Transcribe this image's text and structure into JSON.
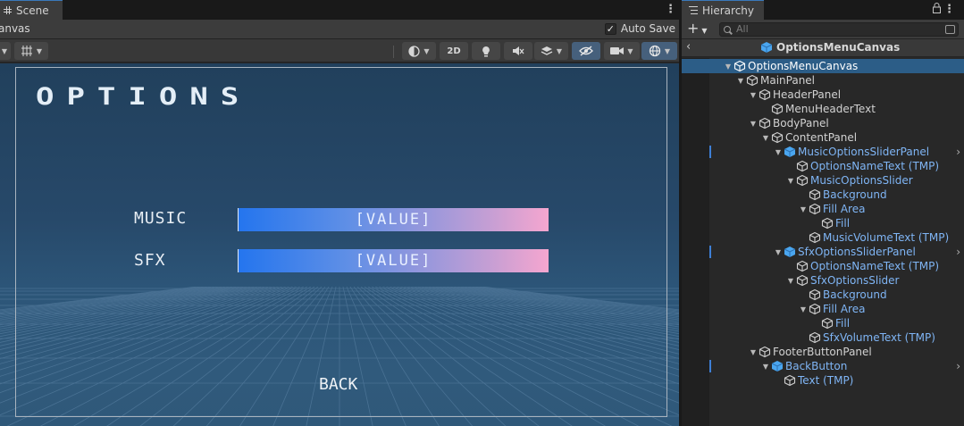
{
  "scene": {
    "tab_label": "Scene",
    "breadcrumb": "anvas",
    "auto_save_label": "Auto Save",
    "auto_save_checked": "✓",
    "toolbar": {
      "mode_2d": "2D"
    },
    "viewport": {
      "options_title": "OPTIONS",
      "rows": [
        {
          "label": "MUSIC",
          "value": "[VALUE]"
        },
        {
          "label": "SFX",
          "value": "[VALUE]"
        }
      ],
      "back_label": "BACK"
    }
  },
  "hierarchy": {
    "tab_label": "Hierarchy",
    "search_placeholder": "All",
    "prefab_title": "OptionsMenuCanvas",
    "items": [
      {
        "label": "OptionsMenuCanvas",
        "type": "normal",
        "selected": true
      },
      {
        "label": "MainPanel",
        "type": "normal"
      },
      {
        "label": "HeaderPanel",
        "type": "normal"
      },
      {
        "label": "MenuHeaderText",
        "type": "normal"
      },
      {
        "label": "BodyPanel",
        "type": "normal"
      },
      {
        "label": "ContentPanel",
        "type": "normal"
      },
      {
        "label": "MusicOptionsSliderPanel",
        "type": "prefab-root"
      },
      {
        "label": "OptionsNameText (TMP)",
        "type": "prefab"
      },
      {
        "label": "MusicOptionsSlider",
        "type": "prefab"
      },
      {
        "label": "Background",
        "type": "prefab"
      },
      {
        "label": "Fill Area",
        "type": "prefab"
      },
      {
        "label": "Fill",
        "type": "prefab"
      },
      {
        "label": "MusicVolumeText (TMP)",
        "type": "prefab"
      },
      {
        "label": "SfxOptionsSliderPanel",
        "type": "prefab-root"
      },
      {
        "label": "OptionsNameText (TMP)",
        "type": "prefab"
      },
      {
        "label": "SfxOptionsSlider",
        "type": "prefab"
      },
      {
        "label": "Background",
        "type": "prefab"
      },
      {
        "label": "Fill Area",
        "type": "prefab"
      },
      {
        "label": "Fill",
        "type": "prefab"
      },
      {
        "label": "SfxVolumeText (TMP)",
        "type": "prefab"
      },
      {
        "label": "FooterButtonPanel",
        "type": "normal"
      },
      {
        "label": "BackButton",
        "type": "prefab-root"
      },
      {
        "label": "Text (TMP)",
        "type": "prefab"
      }
    ]
  },
  "colors": {
    "accent_selected": "#2c5d87",
    "prefab_text": "#7fb5f5",
    "slider_start": "#2475ee",
    "slider_end": "#f5a6cf"
  }
}
